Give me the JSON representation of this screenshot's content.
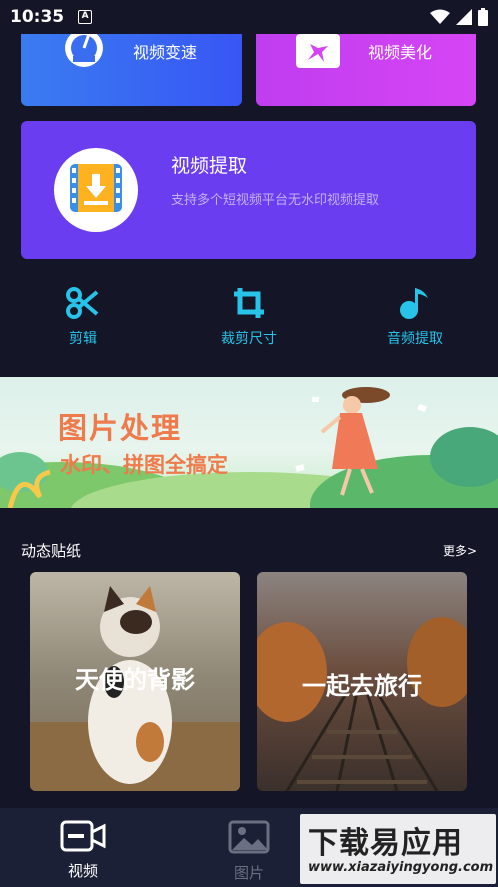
{
  "status_bar": {
    "time": "10:35",
    "badge": "A"
  },
  "top_cards": [
    {
      "label": "视频变速",
      "color": "#3856f5"
    },
    {
      "label": "视频美化",
      "color": "#d545f5"
    }
  ],
  "extract_card": {
    "title": "视频提取",
    "subtitle": "支持多个短视频平台无水印视频提取",
    "color": "#6a3df0"
  },
  "tools": [
    {
      "label": "剪辑",
      "icon": "scissors-icon"
    },
    {
      "label": "裁剪尺寸",
      "icon": "crop-icon"
    },
    {
      "label": "音频提取",
      "icon": "music-note-icon"
    }
  ],
  "banner": {
    "line1": "图片处理",
    "line2": "水印、拼图全搞定"
  },
  "section": {
    "title": "动态贴纸",
    "more": "更多>"
  },
  "stickers": [
    {
      "caption": "天使的背影"
    },
    {
      "caption": "一起去旅行"
    }
  ],
  "bottom_nav": [
    {
      "label": "视频",
      "icon": "video-camera-icon",
      "active": true
    },
    {
      "label": "图片",
      "icon": "image-icon",
      "active": false
    }
  ],
  "watermark": {
    "line1": "下载易应用",
    "line2": "www.xiazaiyingyong.com"
  },
  "accent_color": "#27c3e8"
}
